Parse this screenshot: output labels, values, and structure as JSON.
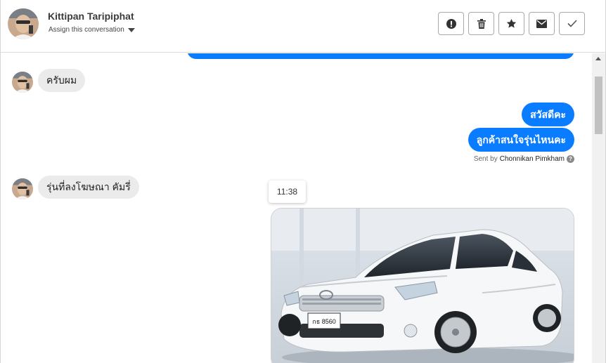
{
  "header": {
    "contact_name": "Kittipan Taripiphat",
    "assign_label": "Assign this conversation",
    "actions": [
      {
        "name": "spam-button",
        "icon": "exclamation-icon"
      },
      {
        "name": "delete-button",
        "icon": "trash-icon"
      },
      {
        "name": "star-button",
        "icon": "star-icon"
      },
      {
        "name": "mark-unread-button",
        "icon": "envelope-icon"
      },
      {
        "name": "mark-done-button",
        "icon": "checkmark-icon"
      }
    ]
  },
  "messages": {
    "incoming_1": "ครับผม",
    "outgoing_1": "สวัสดีคะ",
    "outgoing_2": "ลูกค้าสนใจรุ่นไหนคะ",
    "sent_by_prefix": "Sent by",
    "sent_by_name": "Chonnikan Pimkham",
    "incoming_2": "รุ่นที่ลงโฆษณา คัมรี่",
    "timestamp": "11:38",
    "image_plate": "กธ 8560"
  },
  "colors": {
    "outgoing_bubble": "#0a7cff",
    "incoming_bubble": "#ebebeb"
  }
}
